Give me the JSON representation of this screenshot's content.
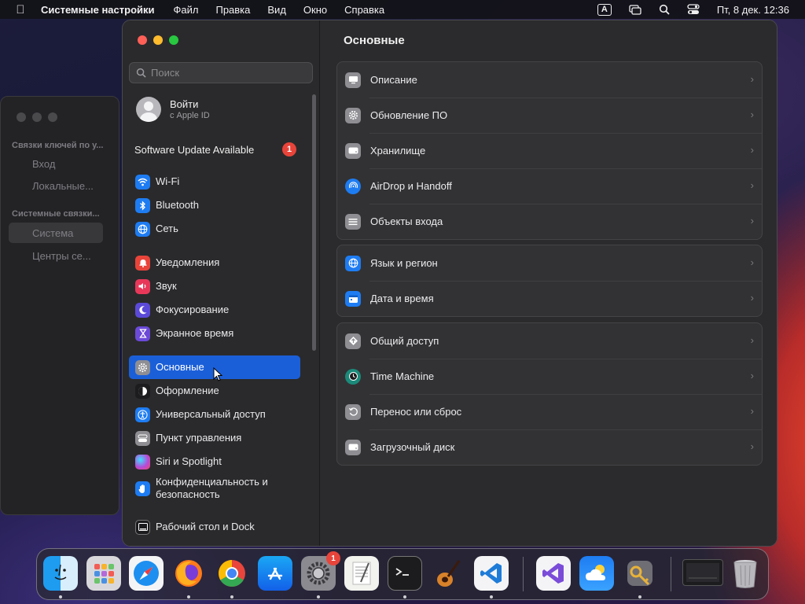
{
  "menubar": {
    "app_name": "Системные настройки",
    "items": [
      "Файл",
      "Правка",
      "Вид",
      "Окно",
      "Справка"
    ],
    "input_indicator": "A",
    "clock": "Пт, 8 дек.  12:36"
  },
  "keychain_window": {
    "section1": "Связки ключей по у...",
    "item1": "Вход",
    "item2": "Локальные...",
    "section2": "Системные связки...",
    "item3": "Система",
    "item4": "Центры се..."
  },
  "sidebar": {
    "search_placeholder": "Поиск",
    "account": {
      "title": "Войти",
      "subtitle": "с Apple ID"
    },
    "update": {
      "label": "Software Update Available",
      "badge": "1"
    },
    "items": [
      {
        "label": "Wi-Fi",
        "icon": "wifi-icon",
        "color": "#1e7cf2"
      },
      {
        "label": "Bluetooth",
        "icon": "bluetooth-icon",
        "color": "#1e7cf2"
      },
      {
        "label": "Сеть",
        "icon": "globe-icon",
        "color": "#1e7cf2"
      },
      {
        "label": "Уведомления",
        "icon": "bell-icon",
        "color": "#e8443a"
      },
      {
        "label": "Звук",
        "icon": "speaker-icon",
        "color": "#e8385a"
      },
      {
        "label": "Фокусирование",
        "icon": "moon-icon",
        "color": "#5b4ad8"
      },
      {
        "label": "Экранное время",
        "icon": "hourglass-icon",
        "color": "#6b4ad8"
      },
      {
        "label": "Основные",
        "icon": "gear-icon",
        "color": "#8e8e93"
      },
      {
        "label": "Оформление",
        "icon": "appearance-icon",
        "color": "#1c1c1e"
      },
      {
        "label": "Универсальный доступ",
        "icon": "accessibility-icon",
        "color": "#1e7cf2"
      },
      {
        "label": "Пункт управления",
        "icon": "control-center-icon",
        "color": "#8e8e93"
      },
      {
        "label": "Siri и Spotlight",
        "icon": "siri-icon",
        "color": "#b64ad8"
      },
      {
        "label": "Конфиденциальность и безопасность",
        "icon": "hand-icon",
        "color": "#1e7cf2"
      },
      {
        "label": "Рабочий стол и Dock",
        "icon": "dock-icon",
        "color": "#1c1c1e"
      }
    ]
  },
  "content": {
    "title": "Основные",
    "groups": [
      [
        {
          "label": "Описание",
          "icon": "display-icon"
        },
        {
          "label": "Обновление ПО",
          "icon": "gear-badge-icon"
        },
        {
          "label": "Хранилище",
          "icon": "drive-icon"
        },
        {
          "label": "AirDrop и Handoff",
          "icon": "airdrop-icon"
        },
        {
          "label": "Объекты входа",
          "icon": "list-icon"
        }
      ],
      [
        {
          "label": "Язык и регион",
          "icon": "globe-icon"
        },
        {
          "label": "Дата и время",
          "icon": "calendar-icon"
        }
      ],
      [
        {
          "label": "Общий доступ",
          "icon": "sharing-icon"
        },
        {
          "label": "Time Machine",
          "icon": "time-machine-icon"
        },
        {
          "label": "Перенос или сброс",
          "icon": "reset-icon"
        },
        {
          "label": "Загрузочный диск",
          "icon": "drive-icon"
        }
      ]
    ]
  },
  "dock": {
    "settings_badge": "1",
    "apps": [
      "finder-icon",
      "launchpad-icon",
      "safari-icon",
      "firefox-icon",
      "chrome-icon",
      "app-store-icon",
      "system-settings-icon",
      "textedit-icon",
      "terminal-icon",
      "garageband-icon",
      "vscode-icon",
      "visual-studio-icon",
      "weather-icon",
      "keychain-icon",
      "screen-icon",
      "trash-icon"
    ]
  }
}
